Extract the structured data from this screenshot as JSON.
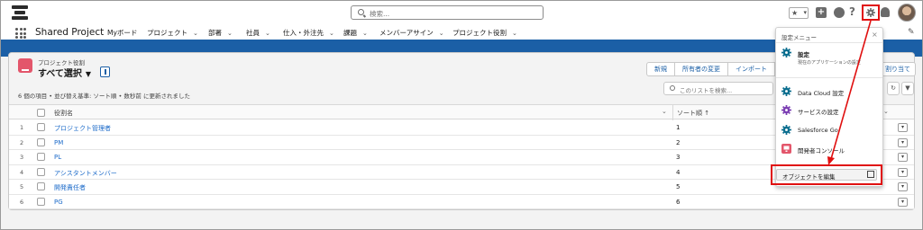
{
  "header": {
    "search_placeholder": "検索...",
    "fav_star": "★",
    "plus_label": "+",
    "help_label": "?"
  },
  "nav": {
    "app_name": "Shared Project",
    "items": [
      {
        "label": "Myボード",
        "has_caret": false
      },
      {
        "label": "プロジェクト",
        "has_caret": true
      },
      {
        "label": "部署",
        "has_caret": true
      },
      {
        "label": "社員",
        "has_caret": true
      },
      {
        "label": "仕入・外注先",
        "has_caret": true
      },
      {
        "label": "課題",
        "has_caret": true
      },
      {
        "label": "メンバーアサイン",
        "has_caret": true
      },
      {
        "label": "プロジェクト役割",
        "has_caret": true
      }
    ]
  },
  "list": {
    "object_label": "プロジェクト役割",
    "view_name": "すべて選択",
    "meta": "6 個の項目 • 並び替え基準: ソート順 • 数秒前 に更新されました",
    "buttons": [
      "新規",
      "所有者の変更",
      "インポート"
    ],
    "right_button": "割り当て",
    "search_placeholder": "このリストを検索..."
  },
  "table": {
    "columns": [
      "役割名",
      "ソート順 ↑"
    ],
    "rows": [
      {
        "num": "1",
        "name": "プロジェクト管理者",
        "sort": "1"
      },
      {
        "num": "2",
        "name": "PM",
        "sort": "2"
      },
      {
        "num": "3",
        "name": "PL",
        "sort": "3"
      },
      {
        "num": "4",
        "name": "アシスタントメンバー",
        "sort": "4"
      },
      {
        "num": "5",
        "name": "開発責任者",
        "sort": "5"
      },
      {
        "num": "6",
        "name": "PG",
        "sort": "6"
      }
    ]
  },
  "setup_menu": {
    "title": "設定メニュー",
    "close": "×",
    "setup_label": "設定",
    "setup_sub": "現在のアプリケーションの設定",
    "items": [
      "Data Cloud 設定",
      "サービスの設定",
      "Salesforce Go",
      "開発者コンソール"
    ],
    "edit_object": "オブジェクトを編集"
  },
  "colors": {
    "brand_blue": "#1b5fa6",
    "link_blue": "#1b6ac9",
    "highlight_red": "#e01010",
    "object_icon": "#e3566b",
    "setup_icon": "#0b6e8f",
    "service_icon": "#7c3fb3",
    "dev_icon": "#e3566b"
  }
}
